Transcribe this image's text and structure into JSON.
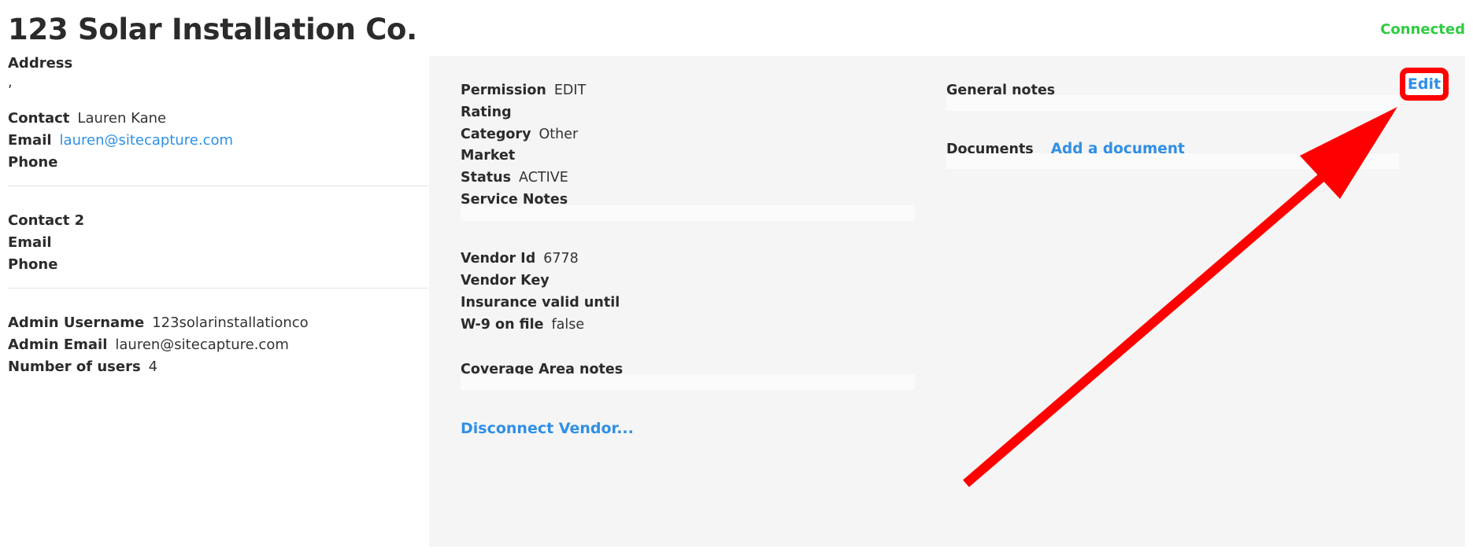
{
  "header": {
    "title": "123 Solar Installation Co.",
    "status": "Connected"
  },
  "left": {
    "address_label": "Address",
    "address_value": ",",
    "contact_label": "Contact",
    "contact_value": "Lauren Kane",
    "email_label": "Email",
    "email_value": "lauren@sitecapture.com",
    "phone_label": "Phone",
    "contact2_label": "Contact 2",
    "email2_label": "Email",
    "phone2_label": "Phone",
    "admin_username_label": "Admin Username",
    "admin_username_value": "123solarinstallationco",
    "admin_email_label": "Admin Email",
    "admin_email_value": "lauren@sitecapture.com",
    "num_users_label": "Number of users",
    "num_users_value": "4"
  },
  "details": {
    "permission_label": "Permission",
    "permission_value": "EDIT",
    "rating_label": "Rating",
    "category_label": "Category",
    "category_value": "Other",
    "market_label": "Market",
    "status_label": "Status",
    "status_value": "ACTIVE",
    "service_notes_label": "Service Notes",
    "vendor_id_label": "Vendor Id",
    "vendor_id_value": "6778",
    "vendor_key_label": "Vendor Key",
    "insurance_label": "Insurance valid until",
    "w9_label": "W-9 on file",
    "w9_value": "false",
    "coverage_label": "Coverage Area notes",
    "disconnect_link": "Disconnect Vendor...",
    "general_notes_label": "General notes",
    "documents_label": "Documents",
    "add_document_link": "Add a document",
    "edit_button": "Edit"
  },
  "colors": {
    "accent": "#2f8fe6",
    "connected": "#2ecc40",
    "annotation": "#ff0000",
    "panel_bg": "#f5f5f5"
  },
  "annotation": {
    "icon": "arrow-icon"
  }
}
